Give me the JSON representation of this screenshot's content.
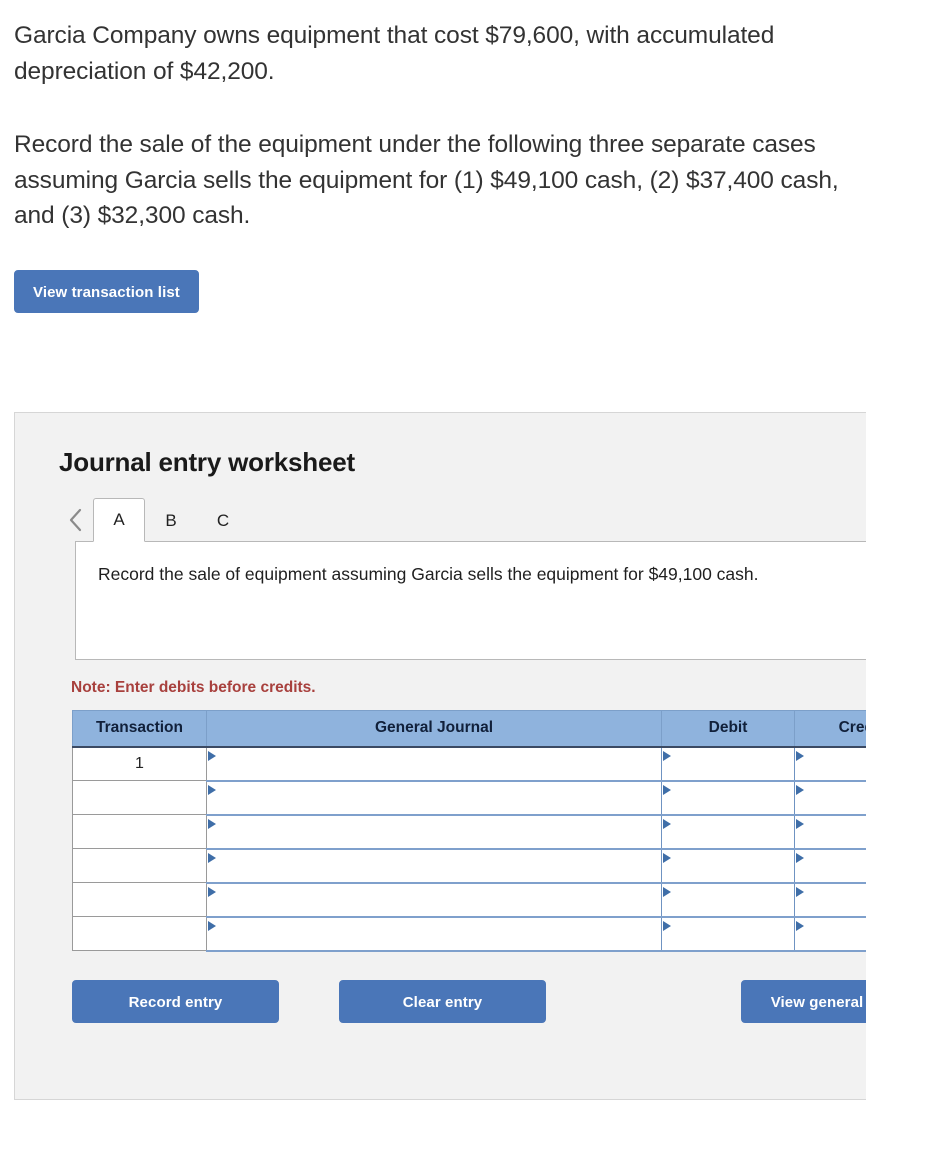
{
  "problem": {
    "paragraph_1": "Garcia Company owns equipment that cost $79,600, with accumulated depreciation of $42,200.",
    "paragraph_2": "Record the sale of the equipment under the following three separate cases assuming Garcia sells the equipment for (1) $49,100 cash, (2) $37,400 cash, and (3) $32,300 cash."
  },
  "toolbar": {
    "view_transaction_list_label": "View transaction list"
  },
  "worksheet": {
    "title": "Journal entry worksheet",
    "prev_icon": "chevron-left-icon",
    "tabs": [
      {
        "label": "A",
        "active": true
      },
      {
        "label": "B",
        "active": false
      },
      {
        "label": "C",
        "active": false
      }
    ],
    "description": "Record the sale of equipment assuming Garcia sells the equipment for $49,100 cash.",
    "note": "Note: Enter debits before credits.",
    "table": {
      "headers": [
        "Transaction",
        "General Journal",
        "Debit",
        "Credit"
      ],
      "rows": [
        {
          "transaction": "1",
          "general_journal": "",
          "debit": "",
          "credit": ""
        },
        {
          "transaction": "",
          "general_journal": "",
          "debit": "",
          "credit": ""
        },
        {
          "transaction": "",
          "general_journal": "",
          "debit": "",
          "credit": ""
        },
        {
          "transaction": "",
          "general_journal": "",
          "debit": "",
          "credit": ""
        },
        {
          "transaction": "",
          "general_journal": "",
          "debit": "",
          "credit": ""
        },
        {
          "transaction": "",
          "general_journal": "",
          "debit": "",
          "credit": ""
        }
      ]
    },
    "buttons": {
      "record_entry": "Record entry",
      "clear_entry": "Clear entry",
      "view_general_journal": "View general journal"
    }
  },
  "colors": {
    "button_blue": "#4a76b8",
    "table_header_blue": "#8fb3dd",
    "note_red": "#a8403d",
    "panel_gray": "#f2f2f2",
    "text_dark": "#333333"
  }
}
